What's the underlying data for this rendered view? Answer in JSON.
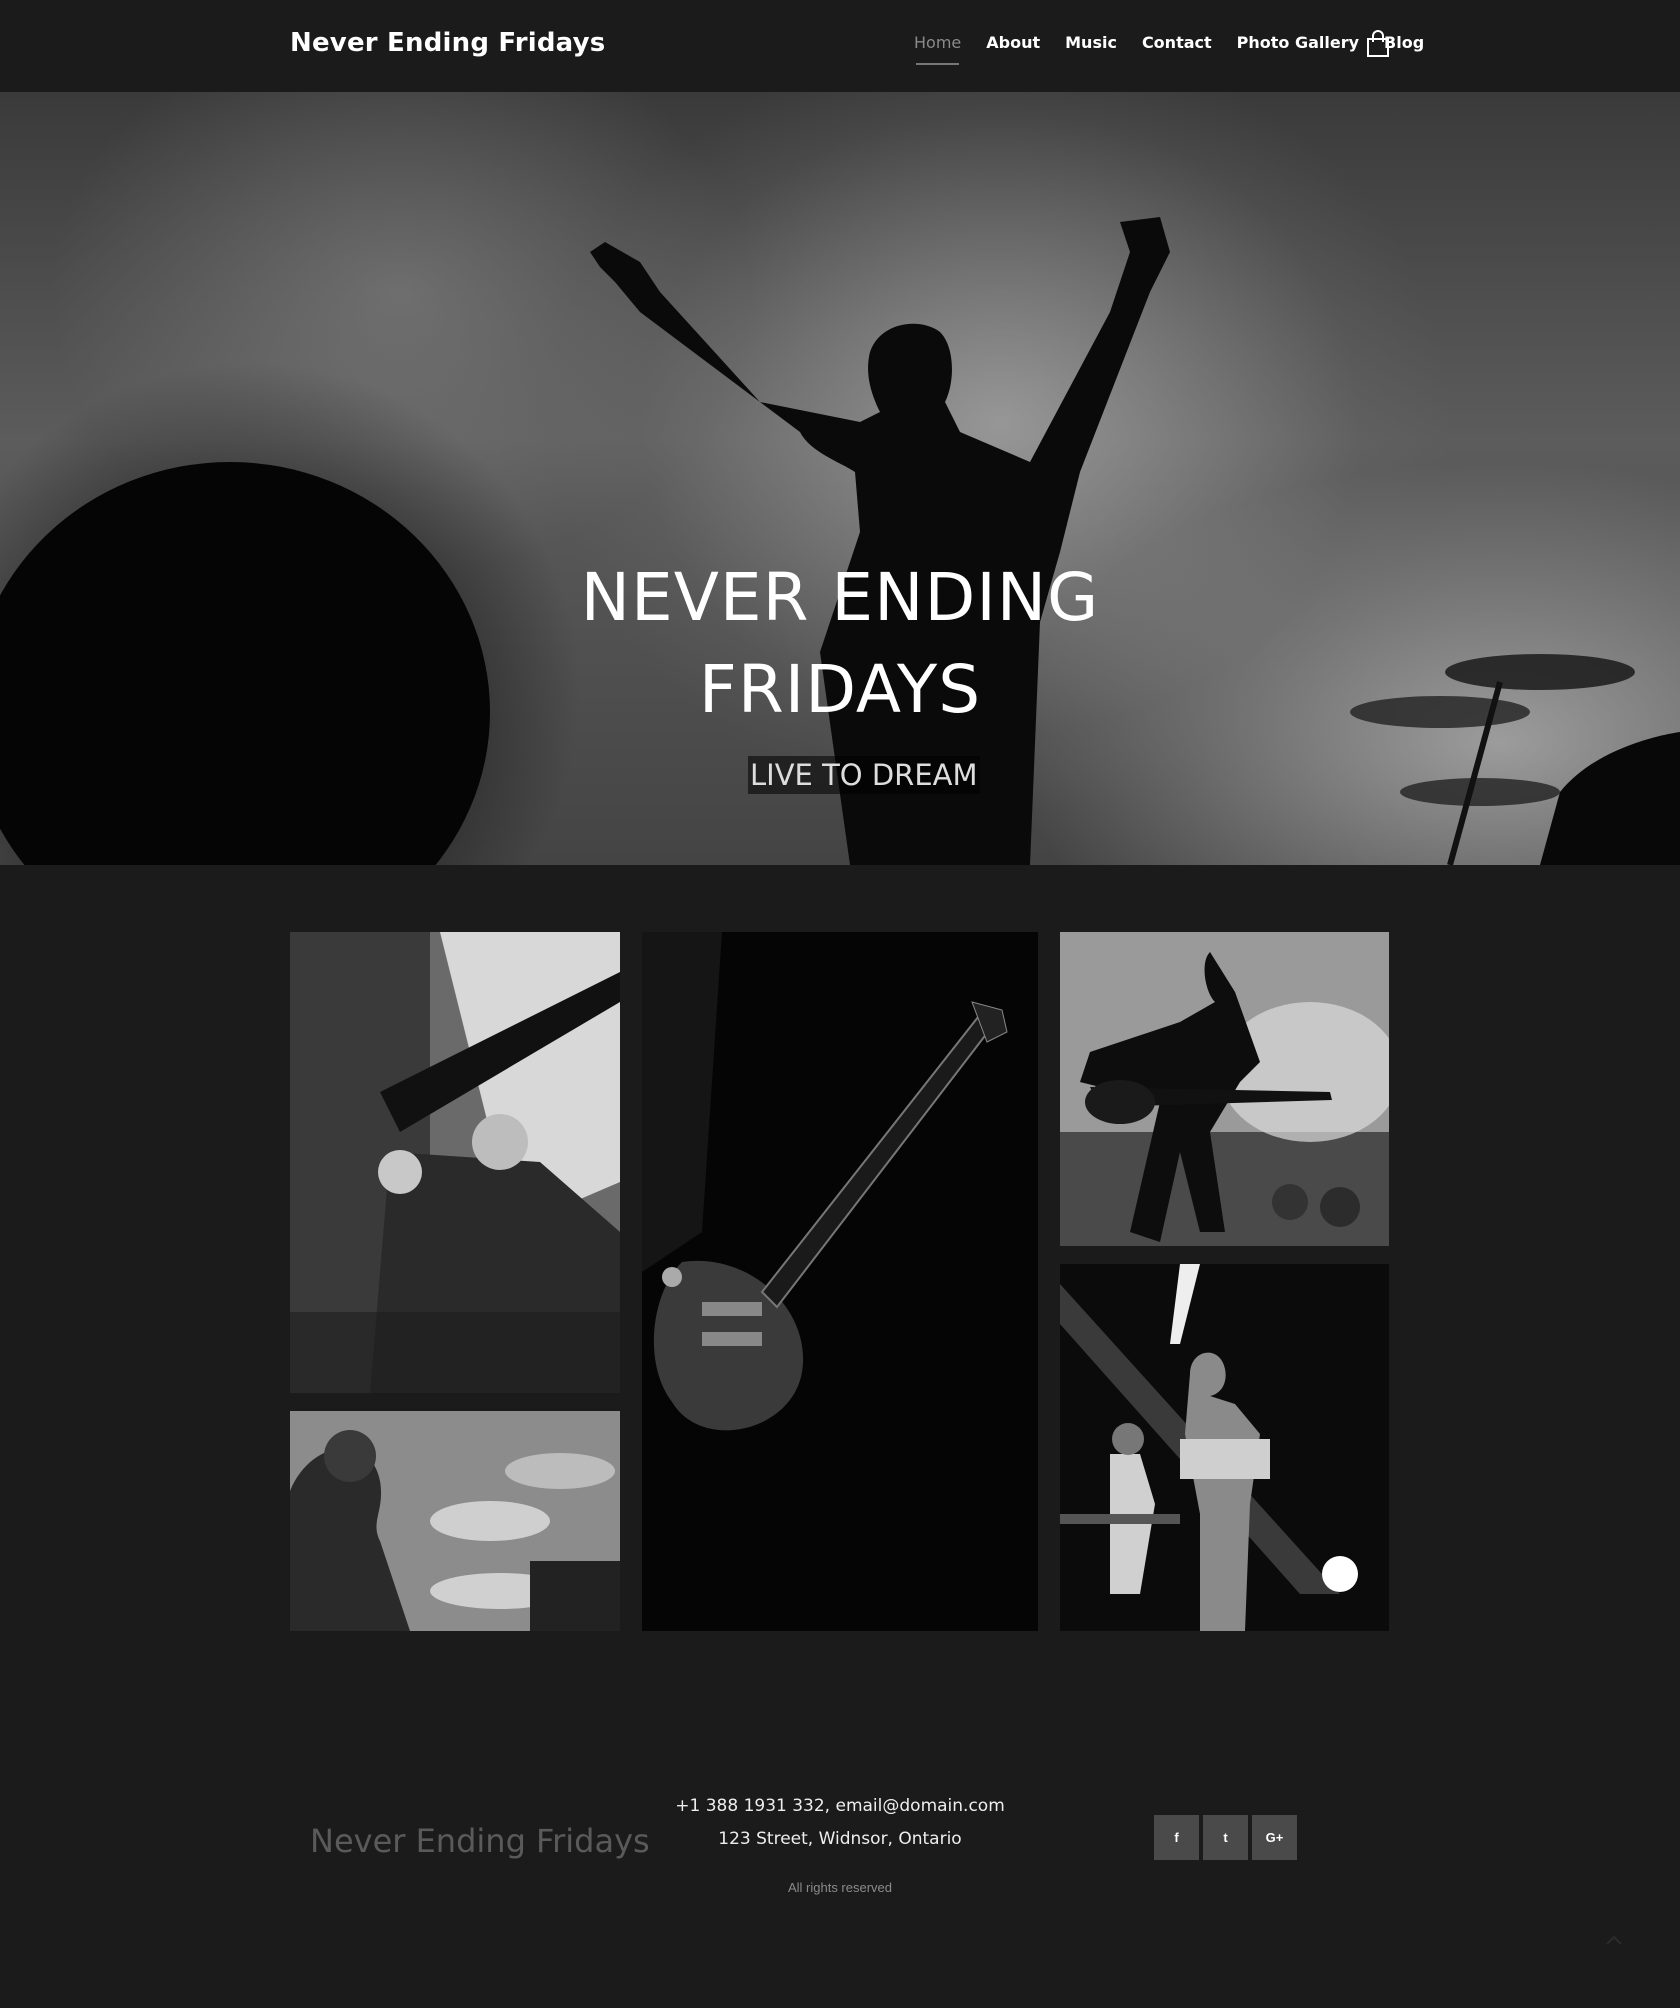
{
  "header": {
    "brand": "Never Ending Fridays",
    "nav": [
      "Home",
      "About",
      "Music",
      "Contact",
      "Photo Gallery",
      "Blog"
    ],
    "active_item": "Home",
    "cart_icon": "shopping-bag-icon"
  },
  "hero": {
    "title_line1": "NEVER ENDING",
    "title_line2": "FRIDAYS",
    "tagline": "LIVE TO DREAM"
  },
  "gallery": {
    "images": [
      "guitarist-closeup-photo",
      "electric-guitar-dark-photo",
      "guitarist-on-stage-photo",
      "drummer-photo",
      "singer-with-guitar-photo"
    ]
  },
  "footer": {
    "brand": "Never Ending Fridays",
    "contact_line": "+1 388 1931 332, email@domain.com",
    "address_line": "123 Street, Widnsor, Ontario",
    "rights": "All rights reserved",
    "social": [
      {
        "icon": "facebook-icon",
        "glyph": "f"
      },
      {
        "icon": "twitter-icon",
        "glyph": "t"
      },
      {
        "icon": "google-plus-icon",
        "glyph": "G+"
      }
    ]
  },
  "colors": {
    "background": "#1b1b1b",
    "nav_active": "#8a8a8a",
    "social_bg": "#4a4a4a"
  }
}
